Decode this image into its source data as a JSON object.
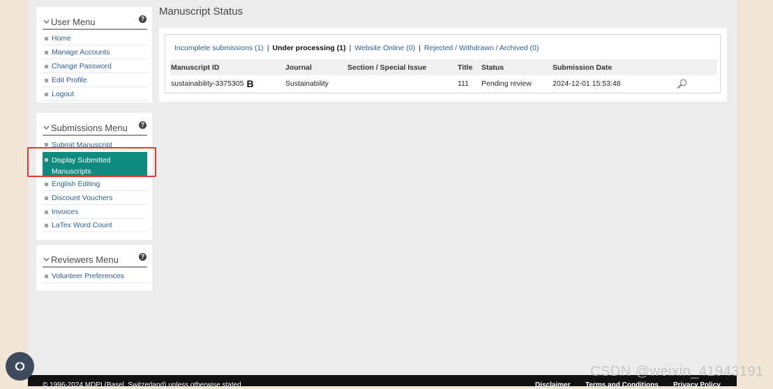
{
  "user_menu": {
    "title": "User Menu",
    "help": "?",
    "items": [
      "Home",
      "Manage Accounts",
      "Change Password",
      "Edit Profile",
      "Logout"
    ]
  },
  "submissions_menu": {
    "title": "Submissions Menu",
    "help": "?",
    "items": [
      "Submit Manuscript",
      "Display Submitted Manuscripts",
      "English Editing",
      "Discount Vouchers",
      "Invoices",
      "LaTex Word Count"
    ],
    "active_line1": "Display Submitted",
    "active_line2": "Manuscripts"
  },
  "reviewers_menu": {
    "title": "Reviewers Menu",
    "help": "?",
    "items": [
      "Volunteer Preferences"
    ]
  },
  "main": {
    "title": "Manuscript Status",
    "tabs": [
      "Incomplete submissions (1)",
      "Under processing (1)",
      "Website Online (0)",
      "Rejected / Withdrawn / Archived (0)"
    ],
    "separator": "|",
    "active_tab_index": 1,
    "columns": [
      "Manuscript ID",
      "Journal",
      "Section / Special Issue",
      "Title",
      "Status",
      "Submission Date"
    ],
    "rows": [
      {
        "id": "sustainability-3375305",
        "badge": "B",
        "journal": "Sustainability",
        "section": "",
        "title": "111",
        "status": "Pending review",
        "date": "2024-12-01 15:53:48",
        "action_icon": "magnifier-icon"
      }
    ]
  },
  "footer": {
    "copyright": "© 1996-2024 MDPI (Basel, Switzerland) unless otherwise stated",
    "links": [
      "Disclaimer",
      "Terms and Conditions",
      "Privacy Policy"
    ]
  },
  "watermark": "CSDN @weixin_41943191",
  "colors": {
    "active_menu_bg": "#0f8a7e",
    "link": "#2f5f90",
    "highlight_border": "#e53935",
    "page_bg": "#f2e7d7"
  },
  "floating_button_icon": "cc-icon"
}
